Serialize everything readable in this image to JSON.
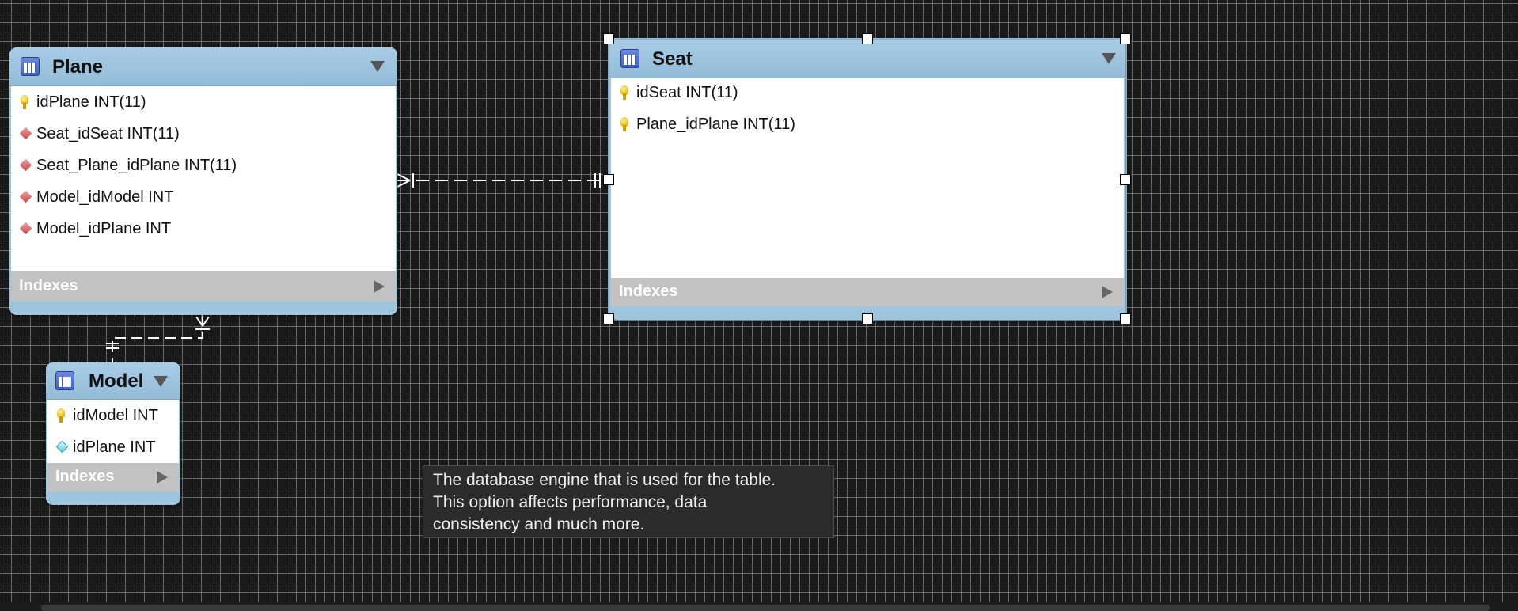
{
  "entities": {
    "plane": {
      "title": "Plane",
      "columns": [
        {
          "icon": "primary-key-icon",
          "text": "idPlane INT(11)"
        },
        {
          "icon": "foreign-key-icon",
          "text": "Seat_idSeat INT(11)"
        },
        {
          "icon": "foreign-key-icon",
          "text": "Seat_Plane_idPlane INT(11)"
        },
        {
          "icon": "foreign-key-icon",
          "text": "Model_idModel INT"
        },
        {
          "icon": "foreign-key-icon",
          "text": "Model_idPlane INT"
        }
      ],
      "indexes_label": "Indexes"
    },
    "seat": {
      "title": "Seat",
      "columns": [
        {
          "icon": "primary-key-icon",
          "text": "idSeat INT(11)"
        },
        {
          "icon": "primary-key-icon",
          "text": "Plane_idPlane INT(11)"
        }
      ],
      "indexes_label": "Indexes",
      "selected": true
    },
    "model": {
      "title": "Model",
      "columns": [
        {
          "icon": "primary-key-icon",
          "text": "idModel INT"
        },
        {
          "icon": "attribute-icon",
          "text": "idPlane INT"
        }
      ],
      "indexes_label": "Indexes"
    }
  },
  "relationships": [
    {
      "from": "Plane",
      "to": "Seat",
      "from_cardinality": "many",
      "to_cardinality": "one"
    },
    {
      "from": "Plane",
      "to": "Model",
      "from_cardinality": "many",
      "to_cardinality": "one"
    }
  ],
  "tooltip": {
    "lines": [
      "The database engine that is used for the table.",
      "This option affects performance, data",
      "consistency and much more."
    ]
  },
  "colors": {
    "canvas": "#1a1a1a",
    "grid": "#6a6a6a",
    "entity_header": "#9fc4dd",
    "indexes_bar": "#c2c2c2",
    "relationship_line": "#ffffff"
  }
}
